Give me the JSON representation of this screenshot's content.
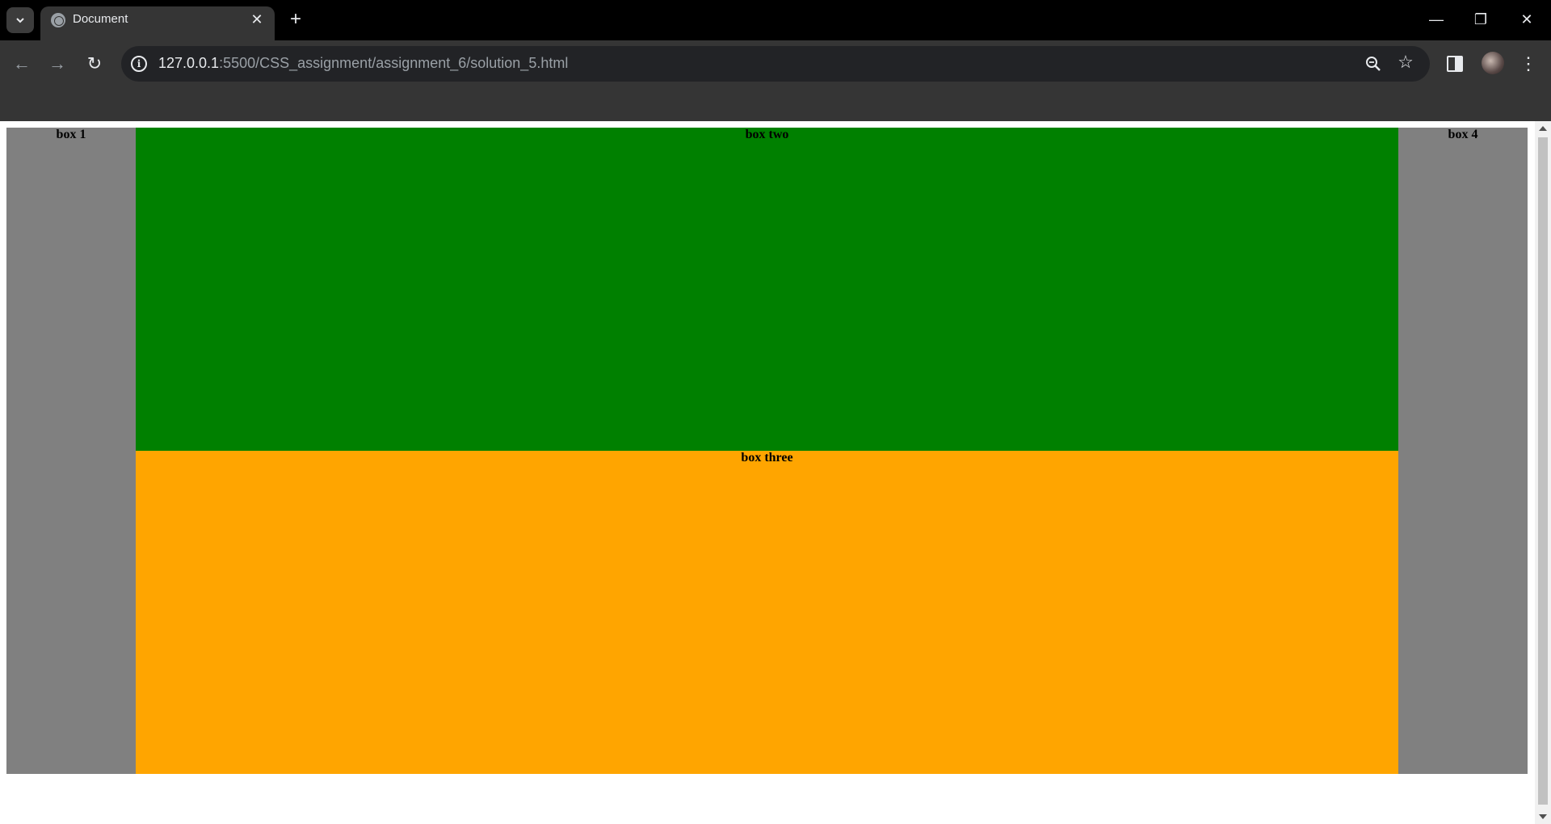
{
  "browser": {
    "tab": {
      "title": "Document",
      "close": "✕"
    },
    "new_tab": "+",
    "window_controls": {
      "minimize": "—",
      "restore": "❐",
      "close": "✕"
    },
    "toolbar": {
      "back": "←",
      "forward": "→",
      "reload": "↻",
      "info_icon": "i",
      "url_host": "127.0.0.1",
      "url_rest": ":5500/CSS_assignment/assignment_6/solution_5.html",
      "star": "☆",
      "menu": "⋮"
    }
  },
  "page": {
    "box1": {
      "label": "box 1",
      "color": "#808080"
    },
    "box2": {
      "label": "box two",
      "color": "#008000"
    },
    "box3": {
      "label": "box three",
      "color": "#ffa500"
    },
    "box4": {
      "label": "box 4",
      "color": "#808080"
    }
  }
}
